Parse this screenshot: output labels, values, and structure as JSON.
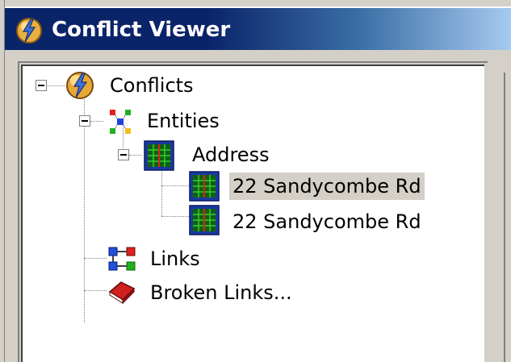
{
  "window": {
    "title": "Conflict Viewer",
    "title_icon": "lightning-sphere-icon",
    "title_colors": {
      "start": "#0a246a",
      "end": "#a6caf0"
    }
  },
  "tree": {
    "root": {
      "label": "Conflicts",
      "icon": "conflict-icon",
      "expanded": true
    },
    "entities": {
      "label": "Entities",
      "icon": "entities-icon",
      "expanded": true
    },
    "address": {
      "label": "Address",
      "icon": "grid-icon",
      "expanded": true
    },
    "address_items": [
      {
        "label": "22 Sandycombe Rd",
        "icon": "grid-icon",
        "selected": true
      },
      {
        "label": "22 Sandycombe Rd",
        "icon": "grid-icon",
        "selected": false
      }
    ],
    "links": {
      "label": "Links",
      "icon": "links-icon"
    },
    "broken_links": {
      "label": "Broken Links...",
      "icon": "broken-link-book-icon"
    }
  }
}
